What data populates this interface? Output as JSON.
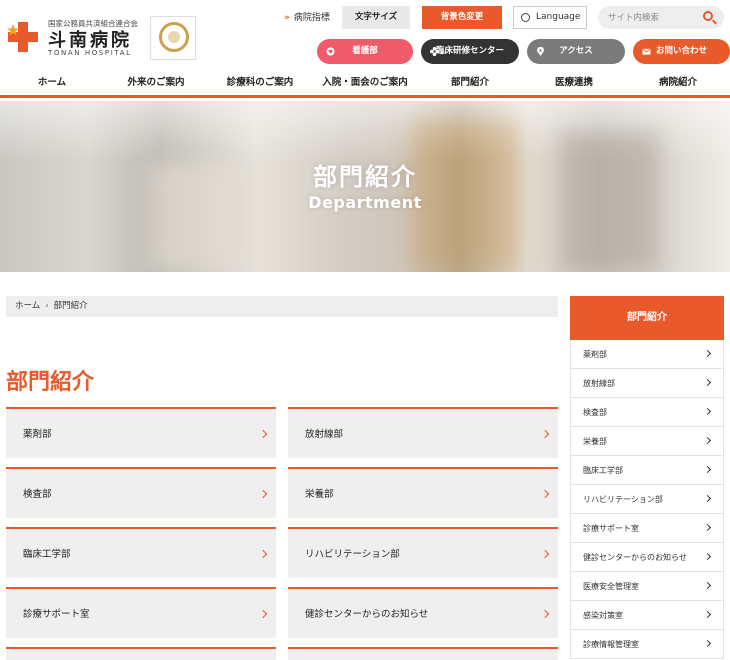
{
  "header": {
    "logo": {
      "org": "国家公務員共済組合連合会",
      "name": "斗南病院",
      "en": "TONAN HOSPITAL"
    },
    "links": {
      "guidance": "病院指標",
      "font_size": "文字サイズ",
      "bg_color": "背景色変更",
      "language": "Language"
    },
    "search": {
      "placeholder": "サイト内検索"
    },
    "pills": {
      "nurse": "看護部",
      "training": "臨床研修センター",
      "access": "アクセス",
      "contact": "お問い合わせ"
    },
    "accent": "#e85a2a"
  },
  "gnav": {
    "items": [
      "ホーム",
      "外来のご案内",
      "診療科のご案内",
      "入院・面会のご案内",
      "部門紹介",
      "医療連携",
      "病院紹介"
    ]
  },
  "hero": {
    "title": "部門紹介",
    "subtitle": "Department"
  },
  "breadcrumb": {
    "home": "ホーム",
    "current": "部門紹介"
  },
  "main": {
    "title": "部門紹介",
    "cards": [
      "薬剤部",
      "放射線部",
      "検査部",
      "栄養部",
      "臨床工学部",
      "リハビリテーション部",
      "診療サポート室",
      "健診センターからのお知らせ"
    ]
  },
  "sidebar": {
    "title": "部門紹介",
    "items": [
      "薬剤部",
      "放射線部",
      "検査部",
      "栄養部",
      "臨床工学部",
      "リハビリテーション部",
      "診療サポート室",
      "健診センターからのお知らせ",
      "医療安全管理室",
      "感染対策室",
      "診療情報管理室"
    ]
  }
}
